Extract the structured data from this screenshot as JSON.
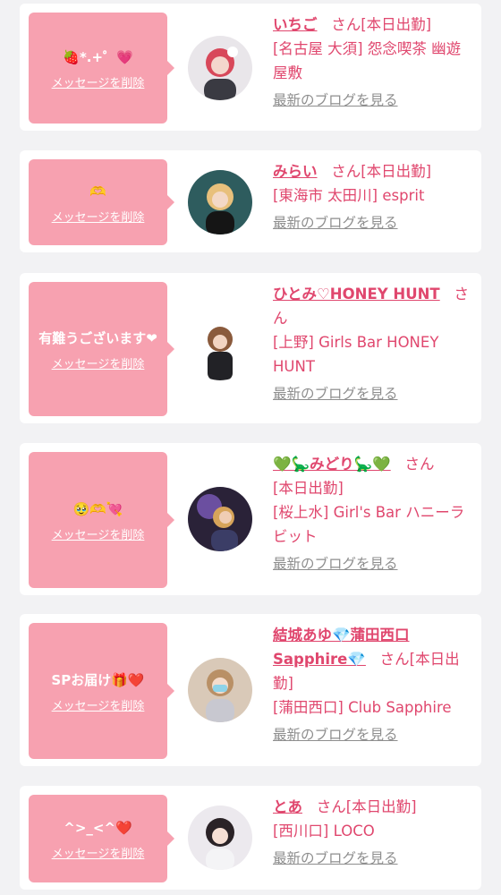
{
  "common": {
    "delete_label": "メッセージを削除",
    "blog_label": "最新のブログを見る",
    "honorific": "さん"
  },
  "cards": [
    {
      "message": "🍓*.+゜💗",
      "name": "いちご",
      "tag": "[本日出勤]",
      "shop": "[名古屋 大須] 怨念喫茶 幽遊屋敷"
    },
    {
      "message": "🫶",
      "name": "みらい",
      "tag": "[本日出勤]",
      "shop": "[東海市 太田川] esprit"
    },
    {
      "message": "有難うございます❤",
      "name": "ひとみ♡HONEY HUNT",
      "tag": "",
      "shop": "[上野] Girls Bar HONEY HUNT"
    },
    {
      "message": "🥹🫶💘",
      "name": "💚🦕みどり🦕💚",
      "tag": "[本日出勤]",
      "shop": "[桜上水] Girl's Bar ハニーラビット"
    },
    {
      "message": "SPお届け🎁❤️",
      "name": "結城あゆ💎蒲田西口Sapphire💎",
      "tag": "[本日出勤]",
      "shop": "[蒲田西口] Club Sapphire"
    },
    {
      "message": "^>_<^❤️",
      "name": "とあ",
      "tag": "[本日出勤]",
      "shop": "[西川口] LOCO"
    }
  ],
  "colors": {
    "accent": "#e0476e",
    "bubble": "#f7a1b0",
    "background": "#f2f2f4",
    "link_gray": "#8e8e8e"
  }
}
